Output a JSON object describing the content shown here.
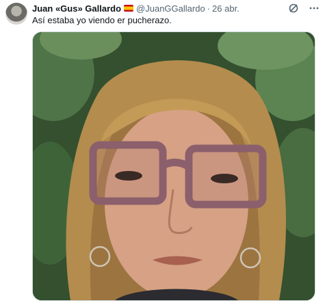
{
  "tweet": {
    "author_name": "Juan «Gus» Gallardo",
    "flag_icon": "spain-flag-icon",
    "handle": "@JuanGGallardo",
    "separator": "·",
    "date": "26 abr.",
    "text": "Así estaba yo viendo er pucherazo."
  },
  "icons": {
    "grok": "grok-icon",
    "more": "more-icon"
  },
  "colors": {
    "text_primary": "#0f1419",
    "text_secondary": "#536471",
    "border": "#cfd9de"
  }
}
